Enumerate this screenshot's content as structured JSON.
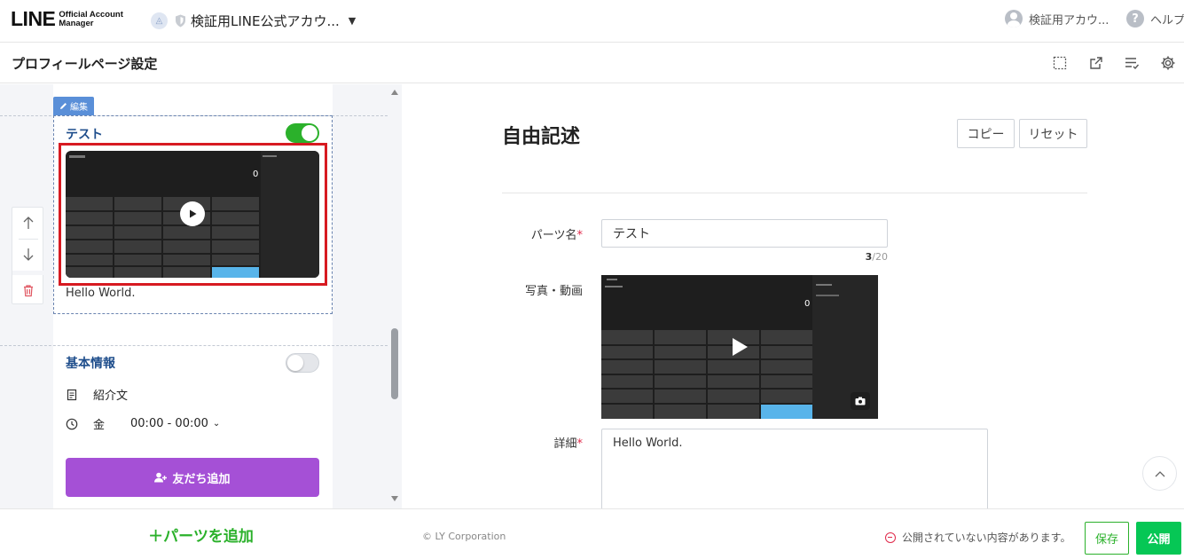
{
  "header": {
    "logo_main": "LINE",
    "logo_sub_1": "Official Account",
    "logo_sub_2": "Manager",
    "account_name": "検証用LINE公式アカウ...",
    "user_name": "検証用アカウ...",
    "help_label": "ヘルプ"
  },
  "subheader": {
    "title": "プロフィールページ設定",
    "tools": [
      "frame-icon",
      "external-link-icon",
      "list-check-icon",
      "gear-icon"
    ]
  },
  "preview": {
    "edit_tag": "編集",
    "section_free": {
      "title": "テスト",
      "toggle_on": true,
      "text": "Hello World.",
      "video_display": "0"
    },
    "section_basic": {
      "title": "基本情報",
      "toggle_on": false,
      "intro_label": "紹介文",
      "hours_day": "金",
      "hours_range": "00:00 - 00:00"
    },
    "add_friend_label": "友だち追加",
    "add_parts_label": "＋パーツを追加"
  },
  "form": {
    "title": "自由記述",
    "copy_label": "コピー",
    "reset_label": "リセット",
    "parts_name_label": "パーツ名",
    "parts_name_value": "テスト",
    "parts_name_count": "3",
    "parts_name_max": "/20",
    "media_label": "写真・動画",
    "detail_label": "詳細",
    "detail_value": "Hello World.",
    "required_mark": "*"
  },
  "footer": {
    "copyright": "© LY Corporation",
    "unpublished_notice": "公開されていない内容があります。",
    "save_label": "保存",
    "publish_label": "公開"
  },
  "colors": {
    "line_green": "#06c755",
    "toggle_green": "#2bb12b",
    "edit_blue": "#5a8fd8",
    "highlight_red": "#d71a21",
    "friend_purple": "#a550d6"
  }
}
